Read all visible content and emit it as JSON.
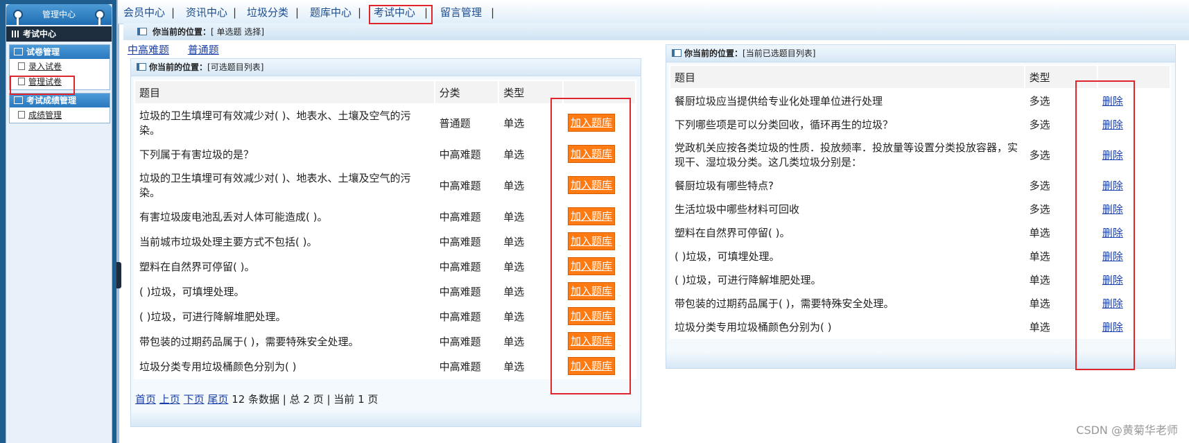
{
  "sidebar": {
    "title": "管理中心",
    "current": "考试中心",
    "sections": [
      {
        "title": "试卷管理",
        "items": [
          {
            "label": "录入试卷"
          },
          {
            "label": "管理试卷"
          }
        ]
      },
      {
        "title": "考试成绩管理",
        "items": [
          {
            "label": "成绩管理"
          }
        ]
      }
    ]
  },
  "topnav": {
    "separator": "|",
    "items": [
      {
        "label": "会员中心"
      },
      {
        "label": "资讯中心"
      },
      {
        "label": "垃圾分类"
      },
      {
        "label": "题库中心"
      },
      {
        "label": "考试中心"
      },
      {
        "label": "留言管理"
      }
    ]
  },
  "location_bar": {
    "prefix": "你当前的位置：",
    "text": "[ 单选题 选择]"
  },
  "filters": [
    {
      "label": "中高难题"
    },
    {
      "label": "普通题"
    }
  ],
  "left_panel": {
    "prefix": "你当前的位置：",
    "text": "[可选题目列表]",
    "columns": [
      "题目",
      "分类",
      "类型",
      ""
    ],
    "button_label": "加入题库",
    "rows": [
      {
        "question": "垃圾的卫生填埋可有效减少对( )、地表水、土壤及空气的污染。",
        "category": "普通题",
        "type": "单选"
      },
      {
        "question": "下列属于有害垃圾的是？",
        "category": "中高难题",
        "type": "单选"
      },
      {
        "question": "垃圾的卫生填埋可有效减少对( )、地表水、土壤及空气的污染。",
        "category": "中高难题",
        "type": "单选"
      },
      {
        "question": "有害垃圾废电池乱丢对人体可能造成( )。",
        "category": "中高难题",
        "type": "单选"
      },
      {
        "question": "当前城市垃圾处理主要方式不包括( )。",
        "category": "中高难题",
        "type": "单选"
      },
      {
        "question": "塑料在自然界可停留( )。",
        "category": "中高难题",
        "type": "单选"
      },
      {
        "question": "( )垃圾，可填埋处理。",
        "category": "中高难题",
        "type": "单选"
      },
      {
        "question": "( )垃圾，可进行降解堆肥处理。",
        "category": "中高难题",
        "type": "单选"
      },
      {
        "question": "带包装的过期药品属于( )，需要特殊安全处理。",
        "category": "中高难题",
        "type": "单选"
      },
      {
        "question": "垃圾分类专用垃圾桶颜色分别为( )",
        "category": "中高难题",
        "type": "单选"
      }
    ],
    "pager": {
      "first": "首页",
      "prev": "上页",
      "next": "下页",
      "last": "尾页",
      "summary": "12 条数据 | 总 2 页 | 当前 1 页"
    }
  },
  "right_panel": {
    "prefix": "你当前的位置：",
    "text": "[当前已选题目列表]",
    "columns": [
      "题目",
      "类型",
      ""
    ],
    "delete_label": "删除",
    "rows": [
      {
        "question": "餐厨垃圾应当提供给专业化处理单位进行处理",
        "type": "多选"
      },
      {
        "question": "下列哪些项是可以分类回收，循环再生的垃圾？",
        "type": "多选"
      },
      {
        "question": "党政机关应按各类垃圾的性质．投放频率．投放量等设置分类投放容器，实现干、湿垃圾分类。这几类垃圾分别是：",
        "type": "多选"
      },
      {
        "question": "餐厨垃圾有哪些特点?",
        "type": "多选"
      },
      {
        "question": "生活垃圾中哪些材料可回收",
        "type": "多选"
      },
      {
        "question": "塑料在自然界可停留( )。",
        "type": "单选"
      },
      {
        "question": "( )垃圾，可填埋处理。",
        "type": "单选"
      },
      {
        "question": "( )垃圾，可进行降解堆肥处理。",
        "type": "单选"
      },
      {
        "question": "带包装的过期药品属于( )，需要特殊安全处理。",
        "type": "单选"
      },
      {
        "question": "垃圾分类专用垃圾桶颜色分别为( )",
        "type": "单选"
      }
    ]
  },
  "watermark": "CSDN @黄菊华老师",
  "colors": {
    "button": "#ff7a12",
    "highlight": "#e0242c",
    "sidebar": "#1f5d8f"
  }
}
